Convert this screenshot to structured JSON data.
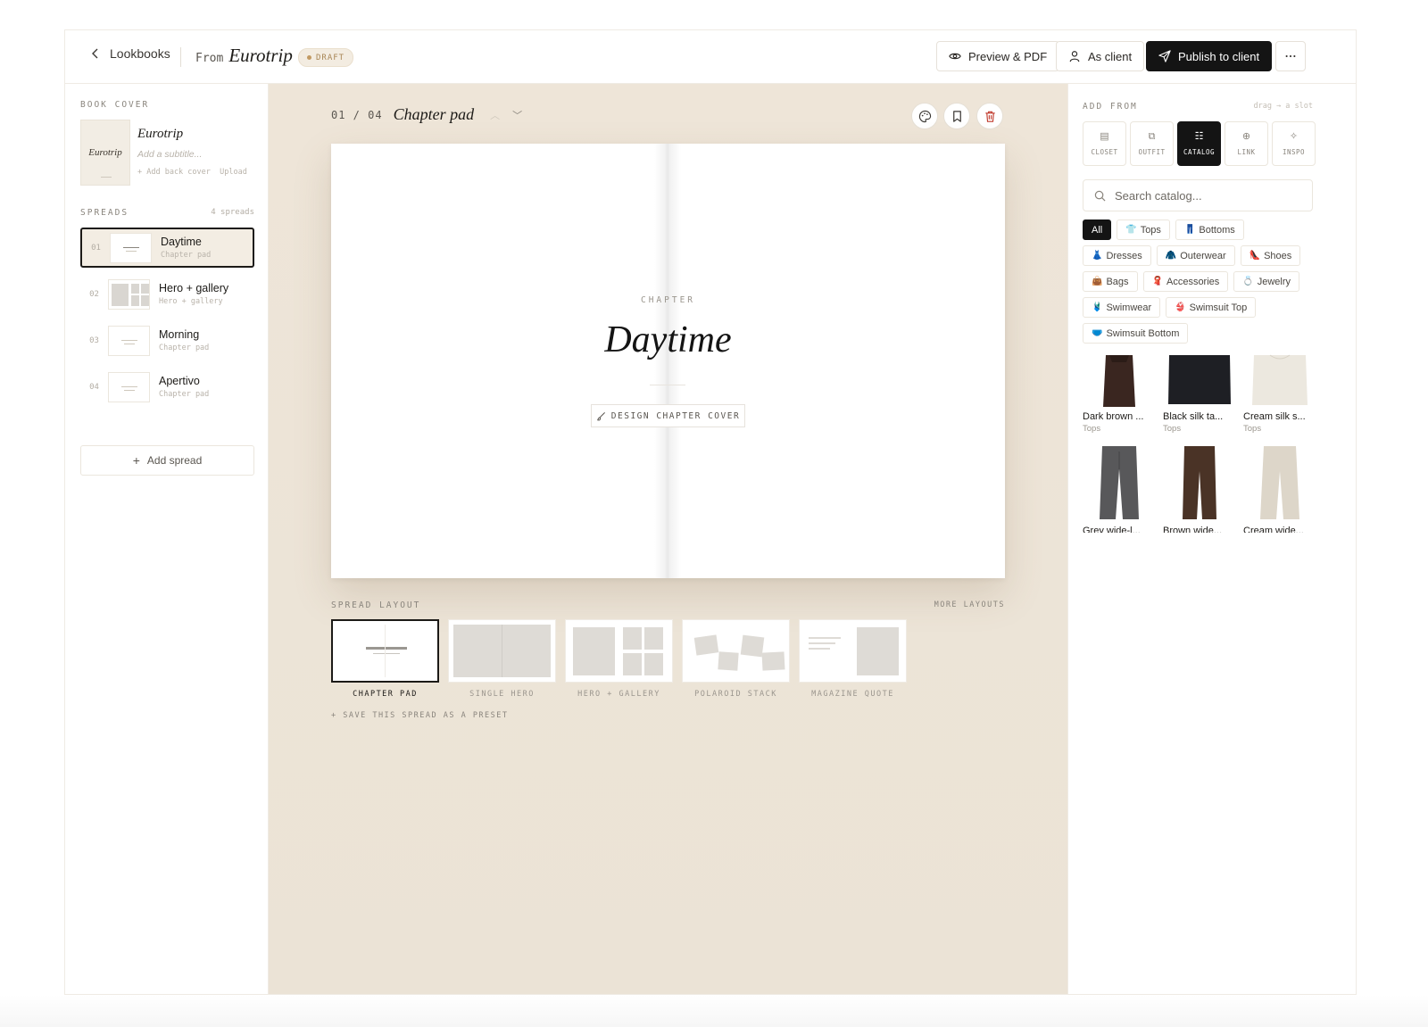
{
  "header": {
    "back_label": "Lookbooks",
    "from_label": "From",
    "book_name": "Eurotrip",
    "status_badge": "DRAFT",
    "preview_label": "Preview & PDF",
    "as_client_label": "As client",
    "publish_label": "Publish to client",
    "more_icon": "ellipsis-icon"
  },
  "sidebar": {
    "cover_section": "BOOK COVER",
    "cover_thumb_text": "Eurotrip",
    "cover_title": "Eurotrip",
    "cover_subtitle_placeholder": "Add a subtitle...",
    "add_back_cover": "+ Add back cover",
    "upload": "Upload",
    "spreads_section": "SPREADS",
    "spreads_count": "4 spreads",
    "spreads": [
      {
        "num": "01",
        "title": "Daytime",
        "subtitle": "Chapter pad",
        "active": true
      },
      {
        "num": "02",
        "title": "Hero + gallery",
        "subtitle": "Hero + gallery",
        "active": false
      },
      {
        "num": "03",
        "title": "Morning",
        "subtitle": "Chapter pad",
        "active": false
      },
      {
        "num": "04",
        "title": "Apertivo",
        "subtitle": "Chapter pad",
        "active": false
      }
    ],
    "add_spread": "Add spread"
  },
  "editor": {
    "index": "01 / 04",
    "title": "Chapter pad",
    "chapter_label": "CHAPTER",
    "chapter_name": "Daytime",
    "design_button": "DESIGN CHAPTER COVER",
    "layout_section": "SPREAD LAYOUT",
    "more_layouts": "MORE LAYOUTS",
    "layouts": [
      {
        "label": "CHAPTER PAD",
        "active": true
      },
      {
        "label": "SINGLE HERO",
        "active": false
      },
      {
        "label": "HERO + GALLERY",
        "active": false
      },
      {
        "label": "POLAROID STACK",
        "active": false
      },
      {
        "label": "MAGAZINE QUOTE",
        "active": false
      }
    ],
    "save_preset": "+ SAVE THIS SPREAD AS A PRESET"
  },
  "panel": {
    "section": "ADD FROM",
    "hint": "drag → a slot",
    "sources": [
      {
        "label": "CLOSET",
        "icon": "closet-icon"
      },
      {
        "label": "OUTFIT",
        "icon": "outfit-icon"
      },
      {
        "label": "CATALOG",
        "icon": "catalog-icon",
        "active": true
      },
      {
        "label": "LINK",
        "icon": "link-icon"
      },
      {
        "label": "INSPO",
        "icon": "inspo-icon"
      }
    ],
    "search_placeholder": "Search catalog...",
    "categories": [
      {
        "label": "All",
        "emoji": "",
        "active": true
      },
      {
        "label": "Tops",
        "emoji": "👕"
      },
      {
        "label": "Bottoms",
        "emoji": "👖"
      },
      {
        "label": "Dresses",
        "emoji": "👗"
      },
      {
        "label": "Outerwear",
        "emoji": "🧥"
      },
      {
        "label": "Shoes",
        "emoji": "👠"
      },
      {
        "label": "Bags",
        "emoji": "👜"
      },
      {
        "label": "Accessories",
        "emoji": "🧣"
      },
      {
        "label": "Jewelry",
        "emoji": "💍"
      },
      {
        "label": "Swimwear",
        "emoji": "🩱"
      },
      {
        "label": "Swimsuit Top",
        "emoji": "👙"
      },
      {
        "label": "Swimsuit Bottom",
        "emoji": "🩲"
      }
    ],
    "items": [
      {
        "name": "Dark brown ...",
        "category": "Tops",
        "color": "#3a2620"
      },
      {
        "name": "Black silk ta...",
        "category": "Tops",
        "color": "#1e1f24"
      },
      {
        "name": "Cream silk s...",
        "category": "Tops",
        "color": "#ece8df"
      },
      {
        "name": "Grey wide-l...",
        "category": "",
        "color": "#58585a"
      },
      {
        "name": "Brown wide...",
        "category": "",
        "color": "#4a3326"
      },
      {
        "name": "Cream wide...",
        "category": "",
        "color": "#ddd6c9"
      }
    ]
  }
}
